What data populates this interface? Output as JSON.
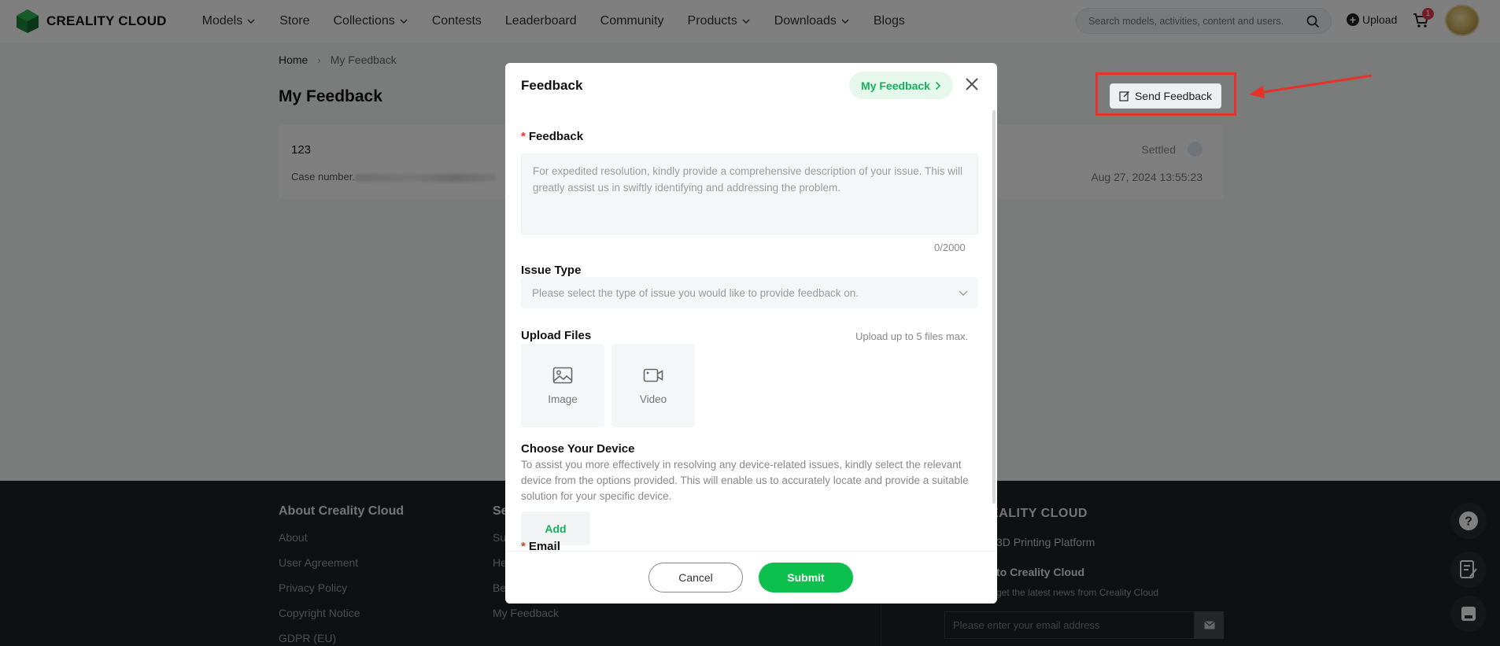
{
  "header": {
    "logo_text": "CREALITY CLOUD",
    "nav": [
      {
        "label": "Models",
        "dropdown": true
      },
      {
        "label": "Store",
        "dropdown": false
      },
      {
        "label": "Collections",
        "dropdown": true
      },
      {
        "label": "Contests",
        "dropdown": false
      },
      {
        "label": "Leaderboard",
        "dropdown": false
      },
      {
        "label": "Community",
        "dropdown": false
      },
      {
        "label": "Products",
        "dropdown": true
      },
      {
        "label": "Downloads",
        "dropdown": true
      },
      {
        "label": "Blogs",
        "dropdown": false
      }
    ],
    "search_placeholder": "Search models, activities, content and users.",
    "upload_label": "Upload",
    "cart_count": "1"
  },
  "page": {
    "breadcrumb": {
      "home": "Home",
      "current": "My Feedback"
    },
    "title": "My Feedback",
    "send_feedback_label": "Send Feedback",
    "card": {
      "title": "123",
      "case_label": "Case number.",
      "status": "Settled",
      "date": "Aug 27, 2024 13:55:23"
    }
  },
  "footer": {
    "col1": {
      "title": "About Creality Cloud",
      "links": [
        "About",
        "User Agreement",
        "Privacy Policy",
        "Copyright Notice",
        "GDPR (EU)"
      ]
    },
    "col2": {
      "title": "Se",
      "links": [
        "Su",
        "He",
        "Be",
        "My Feedback"
      ]
    },
    "brand": "REALITY CLOUD",
    "platform": "3D Printing Platform",
    "subscribe_title": "to Creality Cloud",
    "subscribe_text": "get the latest news from Creality Cloud",
    "email_placeholder": "Please enter your email address"
  },
  "modal": {
    "title": "Feedback",
    "my_feedback_link": "My Feedback",
    "feedback_label": "Feedback",
    "feedback_placeholder": "For expedited resolution, kindly provide a comprehensive description of your issue. This will greatly assist us in swiftly identifying and addressing the problem.",
    "counter": "0/2000",
    "issue_type_label": "Issue Type",
    "issue_type_placeholder": "Please select the type of issue you would like to provide feedback on.",
    "upload_label": "Upload Files",
    "upload_hint": "Upload up to 5 files max.",
    "upload_image": "Image",
    "upload_video": "Video",
    "device_label": "Choose Your Device",
    "device_desc": "To assist you more effectively in resolving any device-related issues, kindly select the relevant device from the options provided. This will enable us to accurately locate and provide a suitable solution for your specific device.",
    "add_label": "Add",
    "email_label": "Email",
    "cancel_label": "Cancel",
    "submit_label": "Submit"
  },
  "colors": {
    "accent": "#0dbf4c",
    "annotation": "#e6322a"
  }
}
